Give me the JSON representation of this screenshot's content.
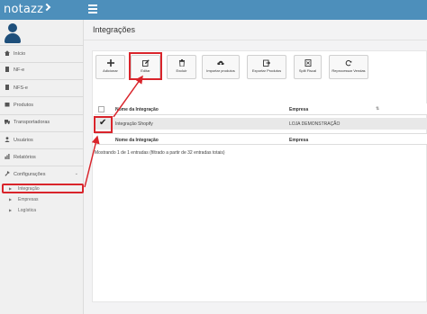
{
  "app": {
    "logo_text": "notazz"
  },
  "sidebar": {
    "items": [
      {
        "label": "Início",
        "icon": "home-icon"
      },
      {
        "label": "NF-e",
        "icon": "document-icon"
      },
      {
        "label": "NFS-e",
        "icon": "document-icon"
      },
      {
        "label": "Produtos",
        "icon": "box-icon"
      },
      {
        "label": "Transportadoras",
        "icon": "truck-icon"
      },
      {
        "label": "Usuários",
        "icon": "users-icon"
      },
      {
        "label": "Relatórios",
        "icon": "chart-icon"
      },
      {
        "label": "Configurações",
        "icon": "wrench-icon"
      }
    ],
    "subitems": [
      {
        "label": "Integração"
      },
      {
        "label": "Empresas"
      },
      {
        "label": "Logística"
      }
    ]
  },
  "main": {
    "title": "Integrações",
    "toolbar": [
      {
        "label": "Adicionar",
        "icon": "plus-icon"
      },
      {
        "label": "Editar",
        "icon": "edit-icon"
      },
      {
        "label": "Excluir",
        "icon": "trash-icon"
      },
      {
        "label": "Importar produtos",
        "icon": "cloud-upload-icon"
      },
      {
        "label": "Exportar Produtos",
        "icon": "export-icon"
      },
      {
        "label": "Split Fiscal",
        "icon": "split-icon"
      },
      {
        "label": "Reprocessar Vendas",
        "icon": "refresh-icon"
      }
    ],
    "table": {
      "columns": [
        "Nome da Integração",
        "Empresa"
      ],
      "rows": [
        {
          "nome": "Integração Shopify",
          "empresa": "LOJA DEMONSTRAÇÃO"
        }
      ],
      "footer_columns": [
        "Nome da Integração",
        "Empresa"
      ]
    },
    "status": "Mostrando 1 de 1 entradas (filtrado a partir de 32 entradas totais)"
  },
  "colors": {
    "header": "#4d8fbb",
    "highlight": "#d9242b"
  }
}
